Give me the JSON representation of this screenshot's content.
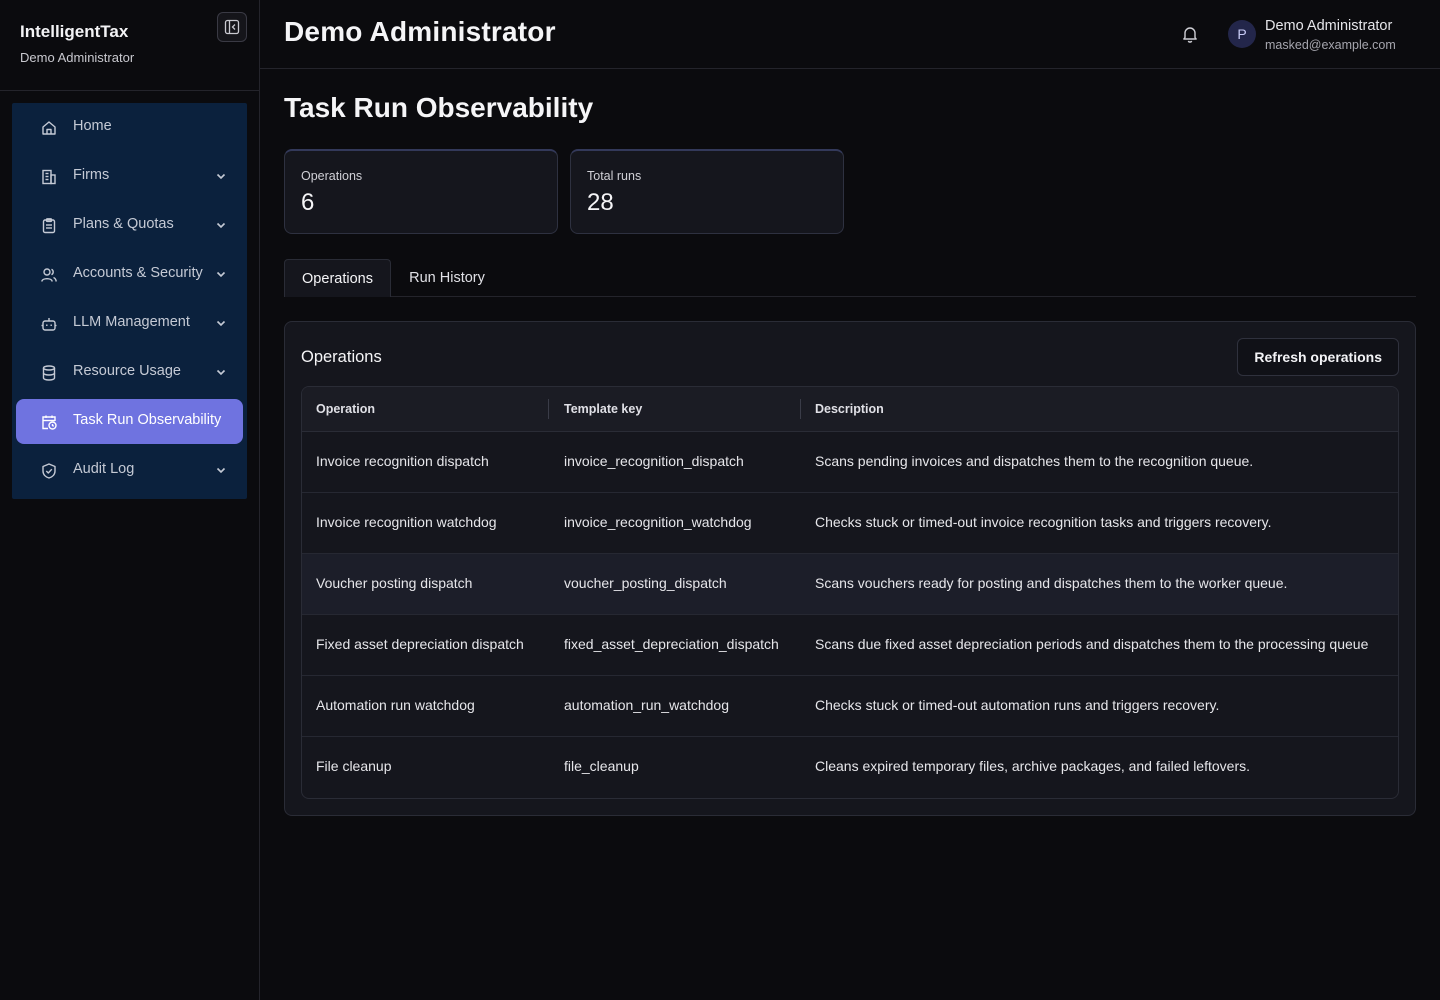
{
  "sidebar": {
    "brand_title": "IntelligentTax",
    "brand_subtitle": "Demo Administrator",
    "items": [
      {
        "label": "Home",
        "icon": "home-icon",
        "has_chevron": false,
        "active": false
      },
      {
        "label": "Firms",
        "icon": "building-icon",
        "has_chevron": true,
        "active": false
      },
      {
        "label": "Plans & Quotas",
        "icon": "clipboard-icon",
        "has_chevron": true,
        "active": false
      },
      {
        "label": "Accounts & Security",
        "icon": "users-icon",
        "has_chevron": true,
        "active": false
      },
      {
        "label": "LLM Management",
        "icon": "bot-icon",
        "has_chevron": true,
        "active": false
      },
      {
        "label": "Resource Usage",
        "icon": "database-icon",
        "has_chevron": true,
        "active": false
      },
      {
        "label": "Task Run Observability",
        "icon": "calendar-clock-icon",
        "has_chevron": false,
        "active": true
      },
      {
        "label": "Audit Log",
        "icon": "shield-check-icon",
        "has_chevron": true,
        "active": false
      }
    ]
  },
  "header": {
    "title": "Demo Administrator",
    "user_initial": "P",
    "user_name": "Demo Administrator",
    "user_email": "masked@example.com"
  },
  "page": {
    "title": "Task Run Observability"
  },
  "stats": [
    {
      "label": "Operations",
      "value": "6"
    },
    {
      "label": "Total runs",
      "value": "28"
    }
  ],
  "tabs": [
    {
      "label": "Operations",
      "active": true
    },
    {
      "label": "Run History",
      "active": false
    }
  ],
  "operations_card": {
    "title": "Operations",
    "refresh_label": "Refresh operations",
    "columns": [
      "Operation",
      "Template key",
      "Description"
    ],
    "rows": [
      {
        "operation": "Invoice recognition dispatch",
        "template_key": "invoice_recognition_dispatch",
        "description": "Scans pending invoices and dispatches them to the recognition queue."
      },
      {
        "operation": "Invoice recognition watchdog",
        "template_key": "invoice_recognition_watchdog",
        "description": "Checks stuck or timed-out invoice recognition tasks and triggers recovery."
      },
      {
        "operation": "Voucher posting dispatch",
        "template_key": "voucher_posting_dispatch",
        "description": "Scans vouchers ready for posting and dispatches them to the worker queue."
      },
      {
        "operation": "Fixed asset depreciation dispatch",
        "template_key": "fixed_asset_depreciation_dispatch",
        "description": "Scans due fixed asset depreciation periods and dispatches them to the processing queue"
      },
      {
        "operation": "Automation run watchdog",
        "template_key": "automation_run_watchdog",
        "description": "Checks stuck or timed-out automation runs and triggers recovery."
      },
      {
        "operation": "File cleanup",
        "template_key": "file_cleanup",
        "description": "Cleans expired temporary files, archive packages, and failed leftovers."
      }
    ]
  }
}
